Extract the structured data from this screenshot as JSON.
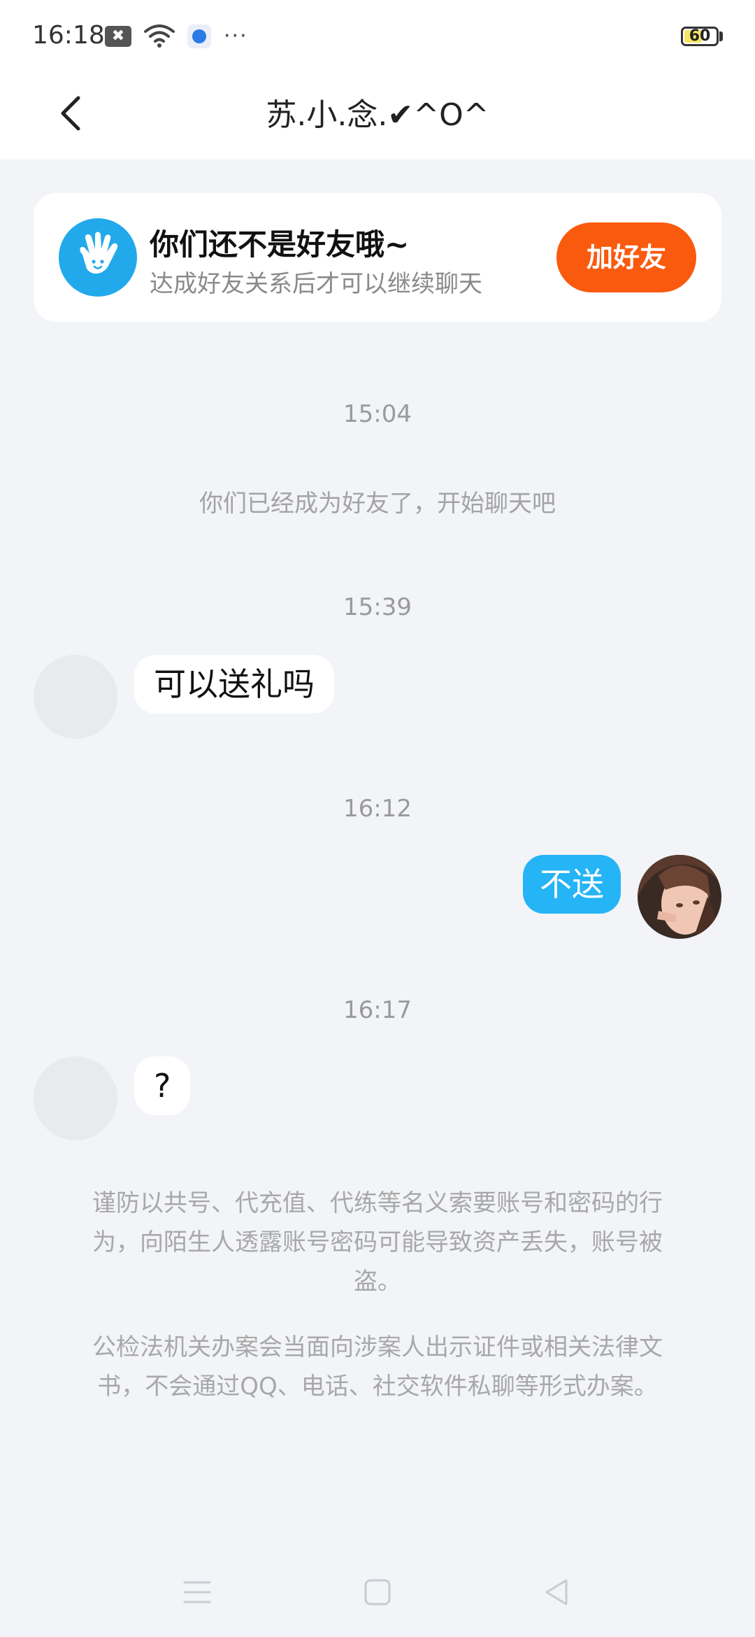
{
  "status_bar": {
    "time": "16:18",
    "notification_icon": "close-box-icon",
    "dots": "···",
    "battery": 60,
    "battery_label": "60"
  },
  "header": {
    "title": "苏.小.念.✔^O^"
  },
  "banner": {
    "title": "你们还不是好友哦~",
    "subtitle": "达成好友关系后才可以继续聊天",
    "add_button": "加好友",
    "accent": "#fa5a0e"
  },
  "chat": {
    "ts1": "15:04",
    "system": "你们已经成为好友了，开始聊天吧",
    "ts2": "15:39",
    "msg1": "可以送礼吗",
    "ts3": "16:12",
    "msg2": "不送",
    "ts4": "16:17",
    "msg3": "?",
    "outgoing_color": "#25b4f5"
  },
  "notices": {
    "n1": "谨防以共号、代充值、代练等名义索要账号和密码的行为，向陌生人透露账号密码可能导致资产丢失，账号被盗。",
    "n2": "公检法机关办案会当面向涉案人出示证件或相关法律文书，不会通过QQ、电话、社交软件私聊等形式办案。"
  }
}
